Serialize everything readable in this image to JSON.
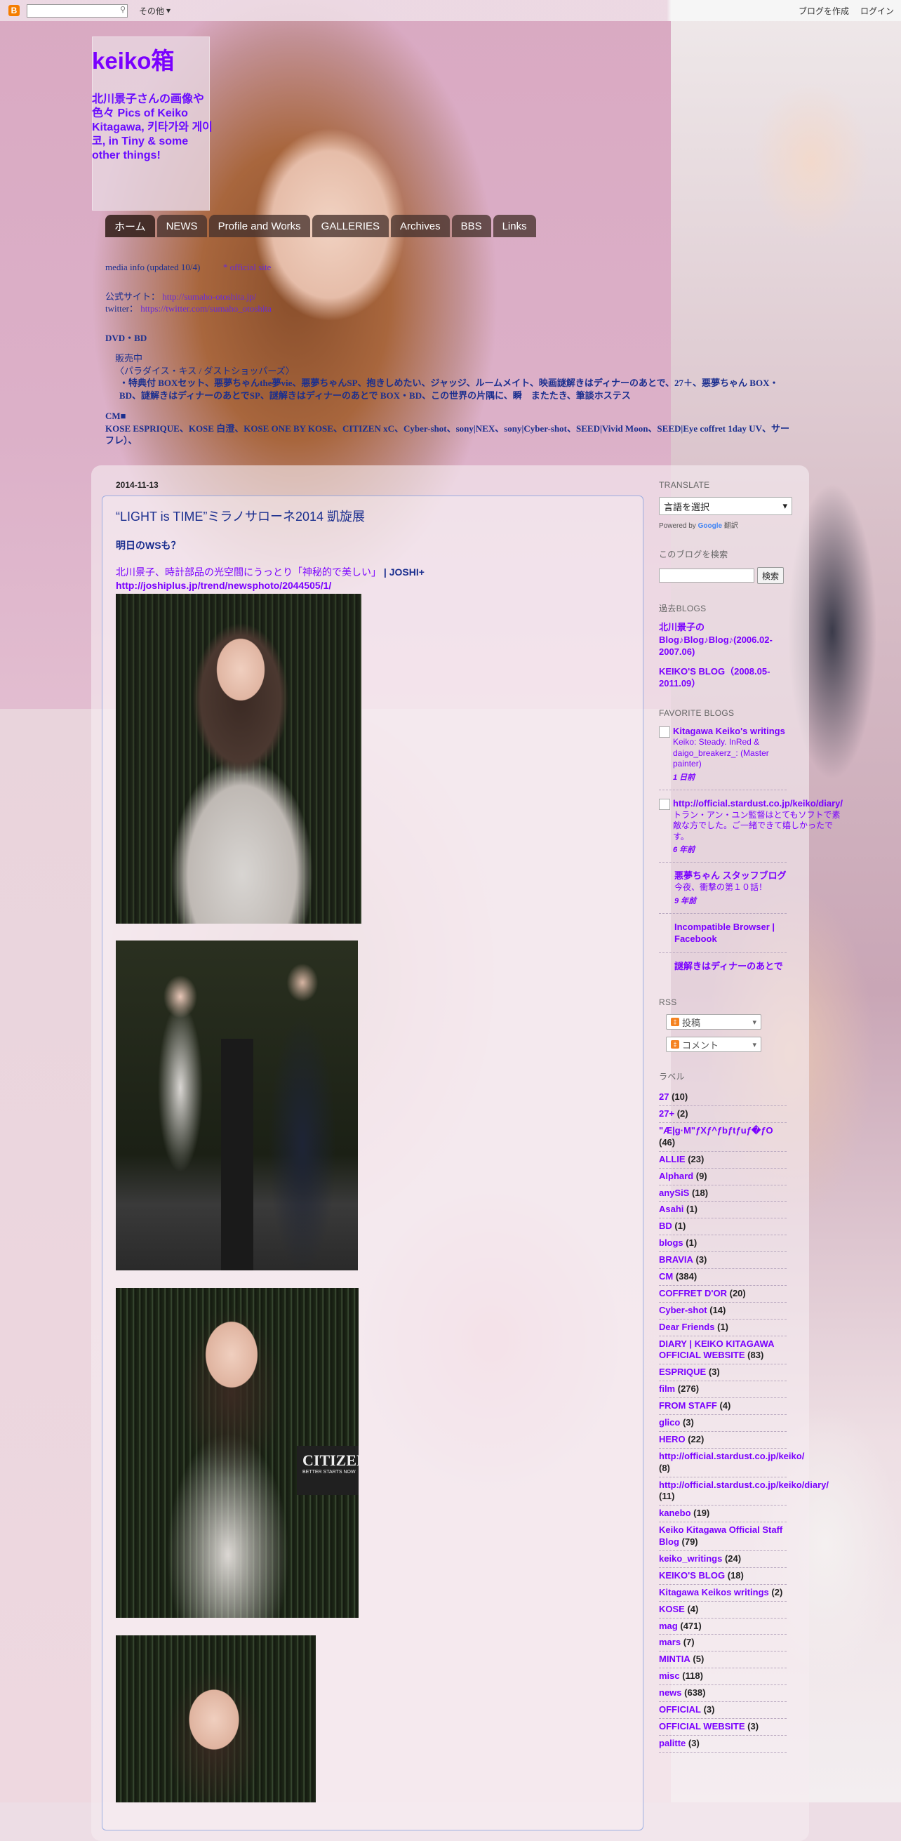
{
  "navbar": {
    "logo_glyph": "B",
    "search_icon": "search-icon",
    "more_label": "その他",
    "create_blog": "ブログを作成",
    "login": "ログイン"
  },
  "header": {
    "title": "keiko箱",
    "description": "北川景子さんの画像や色々 Pics of Keiko Kitagawa, 키타가와 게이코, in Tiny & some other things!"
  },
  "tabs": [
    {
      "label": "ホーム"
    },
    {
      "label": "NEWS"
    },
    {
      "label": "Profile and Works"
    },
    {
      "label": "GALLERIES"
    },
    {
      "label": "Archives"
    },
    {
      "label": "BBS"
    },
    {
      "label": "Links"
    }
  ],
  "notice": {
    "line1": "media info (updated 10/4)",
    "line1_link": "* official site",
    "site_prefix": "公式サイト：",
    "site_url": "http://sumaho-otoshita.jp/",
    "twitter_prefix": "twitter：",
    "twitter_url": "https://twitter.com/sumaho_otoshita",
    "dvd_heading": "DVD・BD",
    "dvd_sub": "販売中",
    "dvd_title": "〈パラダイス・キス / ダストショッパーズ〉",
    "dvd_line1": "・特典付 BOXセット、悪夢ちゃんthe夢vie、悪夢ちゃんSP、抱きしめたい、ジャッジ、ルームメイト、映画謎解きはディナーのあとで、27＋、悪夢ちゃん BOX・BD、謎解きはディナーのあとでSP、謎解きはディナーのあとで BOX・BD、この世界の片隅に、瞬　またたき、筆談ホステス",
    "cm_heading": "CM■",
    "cm_line": "KOSE ESPRIQUE、KOSE 白澄、KOSE ONE BY KOSE、CITIZEN xC、Cyber-shot、sony|NEX、sony|Cyber-shot、SEED|Vivid Moon、SEED|Eye coffret 1day UV、サーフレ）、"
  },
  "post": {
    "date": "2014-11-13",
    "title": "“LIGHT is TIME”ミラノサローネ2014 凱旋展",
    "lead": "明日のWSも？",
    "link_text": "北川景子、時計部品の光空間にうっとり「神秘的で美しい」",
    "link_source": "| JOSHI+",
    "link_url": "http://joshiplus.jp/trend/newsphoto/2044505/1/",
    "sign_text": "CITIZEN",
    "sign_sub": "BETTER STARTS NOW"
  },
  "sidebar": {
    "translate": {
      "title": "TRANSLATE",
      "select_value": "言語を選択",
      "powered_by": "Powered by",
      "google": "Google",
      "translate_word": "翻訳"
    },
    "search": {
      "title": "このブログを検索",
      "button": "検索"
    },
    "past": {
      "title": "過去BLOGS",
      "links": [
        "北川景子の Blog♪Blog♪Blog♪(2006.02-2007.06)",
        "KEIKO'S BLOG（2008.05-2011.09）"
      ]
    },
    "favorite": {
      "title": "FAVORITE BLOGS",
      "items": [
        {
          "title": "Kitagawa Keiko's writings",
          "snippet": "Keiko: Steady. InRed & daigo_breakerz_: (Master painter)",
          "age": "1 日前",
          "icon": true
        },
        {
          "title": "http://official.stardust.co.jp/keiko/diary/",
          "snippet": "トラン・アン・ユン監督はとてもソフトで素敵な方でした。ご一緒できて嬉しかったです。",
          "age": "6 年前",
          "icon": true
        },
        {
          "title": "悪夢ちゃん スタッフブログ",
          "snippet": "今夜、衝撃の第１０話！",
          "age": "9 年前",
          "icon": false
        },
        {
          "title": "Incompatible Browser | Facebook",
          "snippet": "",
          "age": "",
          "icon": false
        },
        {
          "title": "謎解きはディナーのあとで",
          "snippet": "",
          "age": "",
          "icon": false
        }
      ]
    },
    "rss": {
      "title": "RSS",
      "posts": "投稿",
      "comments": "コメント"
    },
    "labels": {
      "title": "ラベル",
      "items": [
        {
          "name": "27",
          "count": "(10)"
        },
        {
          "name": "27+",
          "count": "(2)"
        },
        {
          "name": "\"Æ|g·M\"ƒXƒ^ƒbƒtƒuƒ�ƒO",
          "count": "(46)"
        },
        {
          "name": "ALLIE",
          "count": "(23)"
        },
        {
          "name": "Alphard",
          "count": "(9)"
        },
        {
          "name": "anySiS",
          "count": "(18)"
        },
        {
          "name": "Asahi",
          "count": "(1)"
        },
        {
          "name": "BD",
          "count": "(1)"
        },
        {
          "name": "blogs",
          "count": "(1)"
        },
        {
          "name": "BRAVIA",
          "count": "(3)"
        },
        {
          "name": "CM",
          "count": "(384)"
        },
        {
          "name": "COFFRET D'OR",
          "count": "(20)"
        },
        {
          "name": "Cyber-shot",
          "count": "(14)"
        },
        {
          "name": "Dear Friends",
          "count": "(1)"
        },
        {
          "name": "DIARY | KEIKO KITAGAWA OFFICIAL WEBSITE",
          "count": "(83)"
        },
        {
          "name": "ESPRIQUE",
          "count": "(3)"
        },
        {
          "name": "film",
          "count": "(276)"
        },
        {
          "name": "FROM STAFF",
          "count": "(4)"
        },
        {
          "name": "glico",
          "count": "(3)"
        },
        {
          "name": "HERO",
          "count": "(22)"
        },
        {
          "name": "http://official.stardust.co.jp/keiko/",
          "count": "(8)"
        },
        {
          "name": "http://official.stardust.co.jp/keiko/diary/",
          "count": "(11)"
        },
        {
          "name": "kanebo",
          "count": "(19)"
        },
        {
          "name": "Keiko Kitagawa Official Staff Blog",
          "count": "(79)"
        },
        {
          "name": "keiko_writings",
          "count": "(24)"
        },
        {
          "name": "KEIKO'S BLOG",
          "count": "(18)"
        },
        {
          "name": "Kitagawa Keikos writings",
          "count": "(2)"
        },
        {
          "name": "KOSE",
          "count": "(4)"
        },
        {
          "name": "mag",
          "count": "(471)"
        },
        {
          "name": "mars",
          "count": "(7)"
        },
        {
          "name": "MINTIA",
          "count": "(5)"
        },
        {
          "name": "misc",
          "count": "(118)"
        },
        {
          "name": "news",
          "count": "(638)"
        },
        {
          "name": "OFFICIAL",
          "count": "(3)"
        },
        {
          "name": "OFFICIAL WEBSITE",
          "count": "(3)"
        },
        {
          "name": "palitte",
          "count": "(3)"
        }
      ]
    }
  }
}
